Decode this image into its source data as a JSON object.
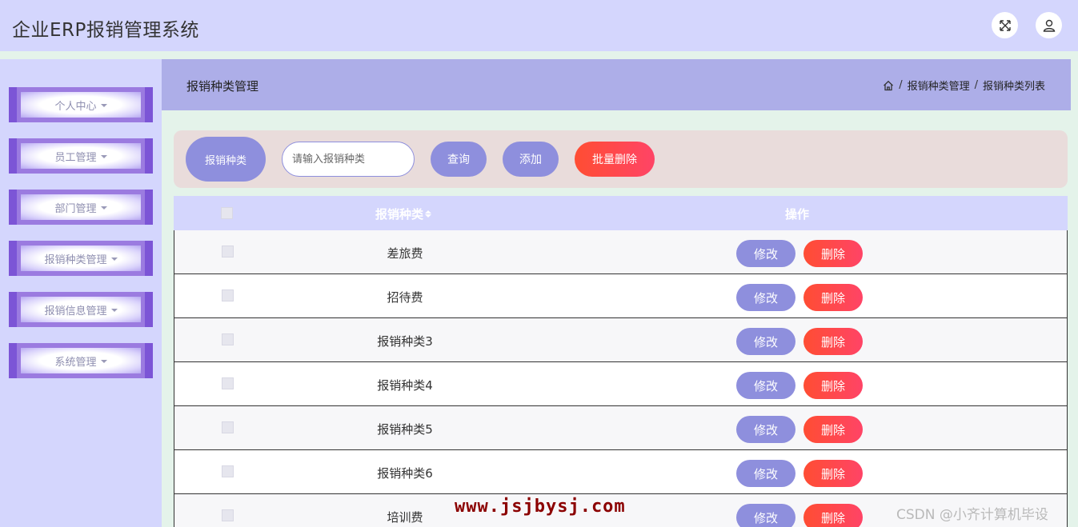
{
  "header": {
    "title": "企业ERP报销管理系统",
    "icons": [
      "fullscreen-icon",
      "user-icon"
    ]
  },
  "sidebar": {
    "items": [
      {
        "label": "个人中心"
      },
      {
        "label": "员工管理"
      },
      {
        "label": "部门管理"
      },
      {
        "label": "报销种类管理"
      },
      {
        "label": "报销信息管理"
      },
      {
        "label": "系统管理"
      }
    ]
  },
  "content_header": {
    "title": "报销种类管理",
    "breadcrumb": [
      "报销种类管理",
      "报销种类列表"
    ],
    "separator": "/"
  },
  "search": {
    "label": "报销种类",
    "placeholder": "请输入报销种类",
    "value": "",
    "query_label": "查询",
    "add_label": "添加",
    "batch_delete_label": "批量删除"
  },
  "table": {
    "columns": [
      "报销种类",
      "操作"
    ],
    "rows": [
      {
        "type": "差旅费"
      },
      {
        "type": "招待费"
      },
      {
        "type": "报销种类3"
      },
      {
        "type": "报销种类4"
      },
      {
        "type": "报销种类5"
      },
      {
        "type": "报销种类6"
      },
      {
        "type": "培训费"
      }
    ],
    "edit_label": "修改",
    "delete_label": "删除"
  },
  "watermark": "www.jsjbysj.com",
  "attribution": "CSDN @小齐计算机毕设",
  "colors": {
    "topbar": "#d4d6fd",
    "accent": "#8e8fdd",
    "danger": "#ff4d4d",
    "header_band": "#adaee8",
    "search_bg": "#e9dcdb",
    "page_bg": "#e4f3ea"
  }
}
